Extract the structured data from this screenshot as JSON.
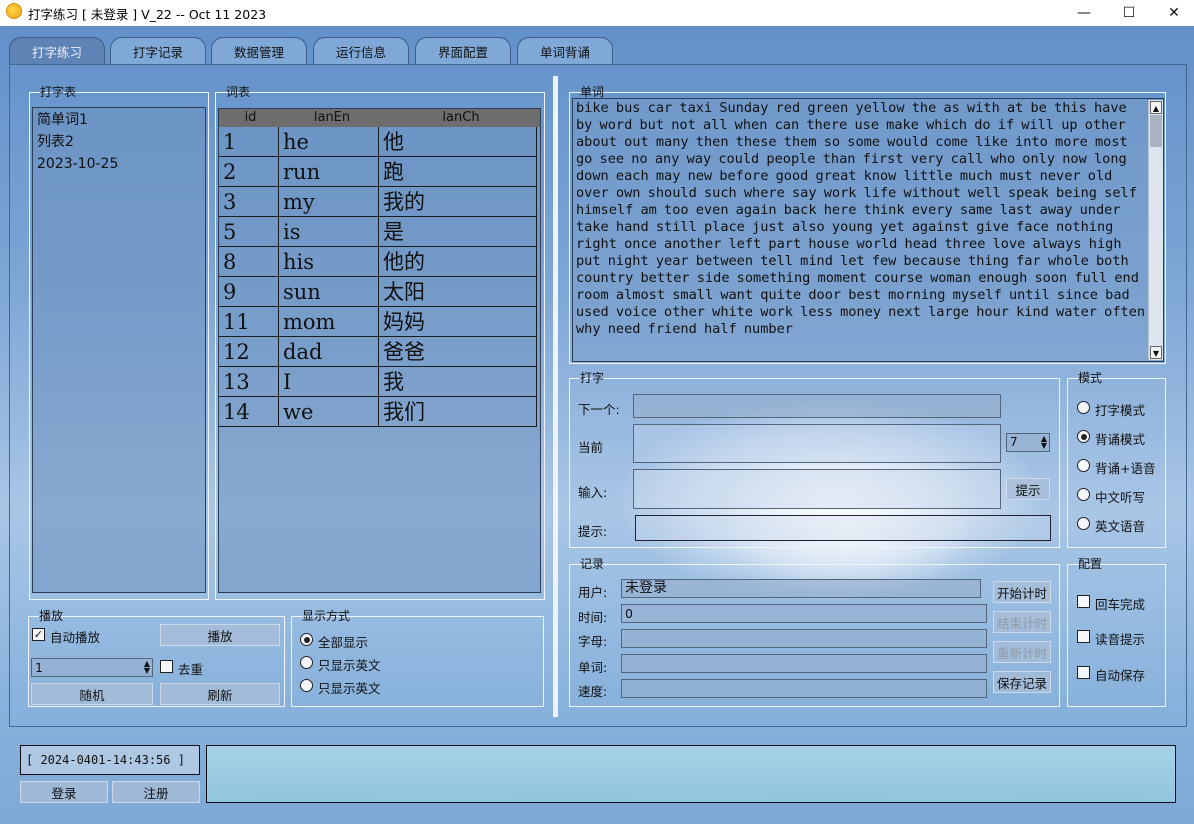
{
  "window": {
    "title": "打字练习 [ 未登录 ] V_22 -- Oct 11 2023",
    "minimize": "—",
    "maximize": "☐",
    "close": "✕"
  },
  "tabs": [
    "打字练习",
    "打字记录",
    "数据管理",
    "运行信息",
    "界面配置",
    "单词背诵"
  ],
  "typing_table": {
    "label": "打字表",
    "items": [
      "简单词1",
      "列表2",
      "2023-10-25"
    ]
  },
  "word_table": {
    "label": "词表",
    "columns": [
      "id",
      "lanEn",
      "lanCh"
    ],
    "rows": [
      [
        "1",
        "he",
        "他"
      ],
      [
        "2",
        "run",
        "跑"
      ],
      [
        "3",
        "my",
        "我的"
      ],
      [
        "5",
        "is",
        "是"
      ],
      [
        "8",
        "his",
        "他的"
      ],
      [
        "9",
        "sun",
        "太阳"
      ],
      [
        "11",
        "mom",
        "妈妈"
      ],
      [
        "12",
        "dad",
        "爸爸"
      ],
      [
        "13",
        "I",
        "我"
      ],
      [
        "14",
        "we",
        "我们"
      ]
    ]
  },
  "playback": {
    "label": "播放",
    "auto_play": "自动播放",
    "play_button": "播放",
    "spin_value": "1",
    "dedupe": "去重",
    "random_button": "随机",
    "refresh_button": "刷新"
  },
  "display_mode": {
    "label": "显示方式",
    "options": [
      "全部显示",
      "只显示英文",
      "只显示英文"
    ],
    "selected": 0
  },
  "words": {
    "label": "单词",
    "text": "bike bus car taxi Sunday red green yellow the as with at be this have by word but not all when can there use make which do if will up other about out many then these them so some would come like into more most go see no any way could people than first very call who only now long down each may new before good great know little much must never old over own should such where say work life without well speak being self himself am too even again back here think every same last away under take hand still place just also young yet against give face nothing right once another left part house world head three love always high put night year between tell mind let few because thing far whole both country better side something moment course woman enough soon full end room almost small want quite door best morning myself until since bad used voice other white work less money next large hour kind water often why need friend half number"
  },
  "typing": {
    "label": "打字",
    "next_label": "下一个:",
    "current_label": "当前",
    "input_label": "输入:",
    "hint_label": "提示:",
    "hint_button": "提示",
    "spin_value": "7"
  },
  "mode": {
    "label": "模式",
    "options": [
      "打字模式",
      "背诵模式",
      "背诵+语音",
      "中文听写",
      "英文语音"
    ],
    "selected": 1
  },
  "record": {
    "label": "记录",
    "user_label": "用户:",
    "user_value": "未登录",
    "time_label": "时间:",
    "time_value": "0",
    "letters_label": "字母:",
    "words_label": "单词:",
    "speed_label": "速度:",
    "start_button": "开始计时",
    "end_button": "结束计时",
    "restart_button": "重新计时",
    "save_button": "保存记录"
  },
  "config": {
    "label": "配置",
    "options": [
      "回车完成",
      "读音提示",
      "自动保存"
    ]
  },
  "status": {
    "datetime": "[ 2024-0401-14:43:56 ]",
    "login_button": "登录",
    "register_button": "注册"
  }
}
